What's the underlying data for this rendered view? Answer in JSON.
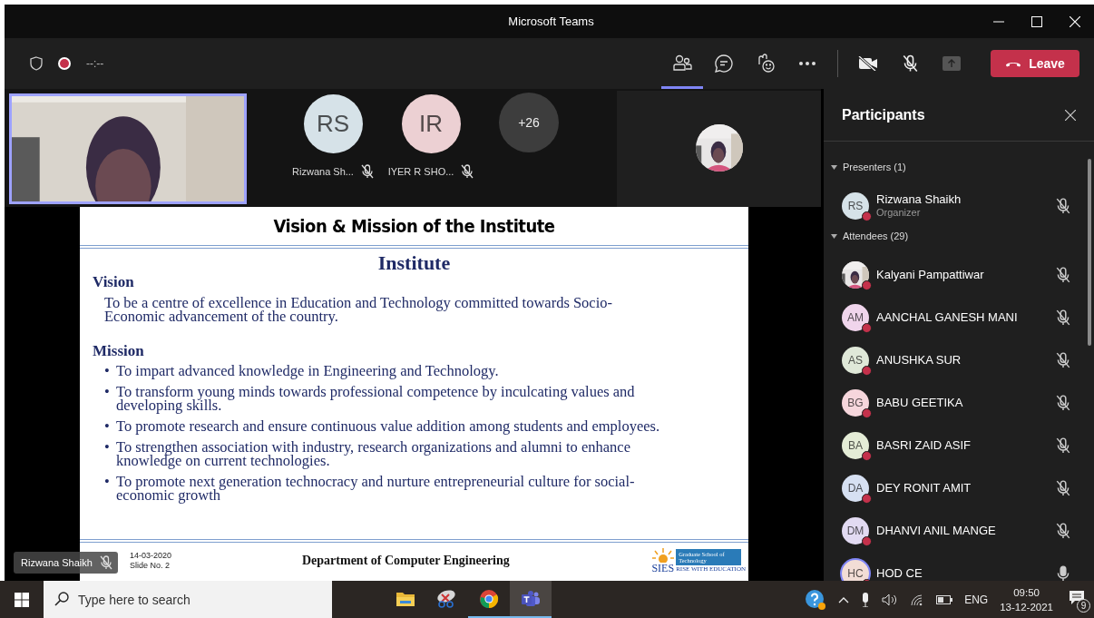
{
  "window": {
    "title": "Microsoft Teams"
  },
  "meeting_bar": {
    "timer": "--:--",
    "recording": true,
    "controls": [
      {
        "kind": "people",
        "selected": true
      },
      {
        "kind": "chat",
        "selected": false
      },
      {
        "kind": "reactions",
        "selected": false
      },
      {
        "kind": "more",
        "selected": false
      }
    ],
    "camera": {
      "on": false
    },
    "microphone": {
      "on": false
    },
    "leave_button": "Leave"
  },
  "stage": {
    "tiles": [
      {
        "kind": "video"
      },
      {
        "kind": "initials",
        "initials": "RS",
        "name": "Rizwana Sh...",
        "muted": true,
        "color": "#d6e2e8"
      },
      {
        "kind": "initials",
        "initials": "IR",
        "name": "IYER R SHO...",
        "muted": true,
        "color": "#ecd0d3"
      },
      {
        "kind": "overflow",
        "count": "+26"
      },
      {
        "kind": "picture"
      }
    ],
    "slide": {
      "title": "Vision & Mission of the Institute",
      "heading": "Institute",
      "sections": [
        {
          "kind": "paragraph",
          "heading": "Vision",
          "items": [
            "To be a centre of excellence in Education and Technology committed towards Socio-Economic advancement of the country."
          ]
        },
        {
          "kind": "bullets",
          "heading": "Mission",
          "marker": "•",
          "items": [
            "To impart advanced knowledge in Engineering and Technology.",
            "To transform young minds towards professional competence by inculcating values and developing skills.",
            "To promote research and ensure continuous value addition among students and employees.",
            "To strengthen association with industry, research organizations and alumni to enhance knowledge on current technologies.",
            "To promote next generation technocracy and nurture entrepreneurial culture for social-economic growth"
          ]
        }
      ],
      "footer": {
        "date": "14-03-2020",
        "slide_number": "Slide No. 2",
        "department": "Department of Computer Engineering",
        "logo_name": "SIES",
        "logo_subtitle": "Graduate School of Technology",
        "logo_tagline": "RISE WITH EDUCATION"
      }
    },
    "name_tag": {
      "name": "Rizwana Shaikh",
      "muted": true
    }
  },
  "participants": {
    "title": "Participants",
    "groups": [
      {
        "label": "Presenters (1)",
        "expanded": true,
        "people": [
          {
            "kind": "initials",
            "initials": "RS",
            "color": "#d6e2e8",
            "name": "Rizwana Shaikh",
            "role": "Organizer",
            "muted": true,
            "speaking": false
          }
        ]
      },
      {
        "label": "Attendees (29)",
        "expanded": true,
        "people": [
          {
            "kind": "picture",
            "name": "Kalyani Pampattiwar",
            "muted": true,
            "speaking": false
          },
          {
            "kind": "initials",
            "initials": "AM",
            "color": "#f0d5ec",
            "name": "AANCHAL GANESH MANI",
            "muted": true,
            "speaking": false
          },
          {
            "kind": "initials",
            "initials": "AS",
            "color": "#dfe8d8",
            "name": "ANUSHKA SUR",
            "muted": true,
            "speaking": false
          },
          {
            "kind": "initials",
            "initials": "BG",
            "color": "#f6d6dc",
            "name": "BABU GEETIKA",
            "muted": true,
            "speaking": false
          },
          {
            "kind": "initials",
            "initials": "BA",
            "color": "#e4ecd6",
            "name": "BASRI ZAID ASIF",
            "muted": true,
            "speaking": false
          },
          {
            "kind": "initials",
            "initials": "DA",
            "color": "#d6e0f2",
            "name": "DEY RONIT AMIT",
            "muted": true,
            "speaking": false
          },
          {
            "kind": "initials",
            "initials": "DM",
            "color": "#e2daf2",
            "name": "DHANVI ANIL MANGE",
            "muted": true,
            "speaking": false
          },
          {
            "kind": "initials",
            "initials": "HC",
            "color": "#f2ddd6",
            "name": "HOD CE",
            "muted": false,
            "speaking": true
          }
        ]
      }
    ]
  },
  "taskbar": {
    "search": {
      "placeholder": "Type here to search"
    },
    "apps": [
      {
        "kind": "folder",
        "running": false,
        "selected": false
      },
      {
        "kind": "snip",
        "running": false,
        "selected": false
      },
      {
        "kind": "browser",
        "running": true,
        "selected": false
      },
      {
        "kind": "teams",
        "running": true,
        "selected": true
      }
    ],
    "tray": {
      "language": "ENG",
      "time": "09:50",
      "date": "13-12-2021",
      "notifications": "9"
    }
  }
}
